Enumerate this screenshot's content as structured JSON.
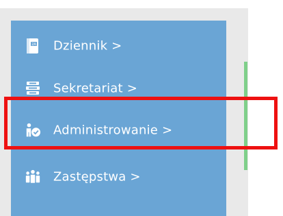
{
  "menu": {
    "items": [
      {
        "label": "Dziennik >",
        "icon": "journal-icon"
      },
      {
        "label": "Sekretariat >",
        "icon": "secretariat-icon"
      },
      {
        "label": "Administrowanie >",
        "icon": "administration-icon"
      },
      {
        "label": "Zastępstwa >",
        "icon": "substitutions-icon"
      }
    ]
  },
  "colors": {
    "menu_background": "#6aa5d5",
    "panel_background": "#e9e9e9",
    "scrollbar": "#7fcf8a",
    "highlight": "#ee1111",
    "text": "#ffffff"
  }
}
